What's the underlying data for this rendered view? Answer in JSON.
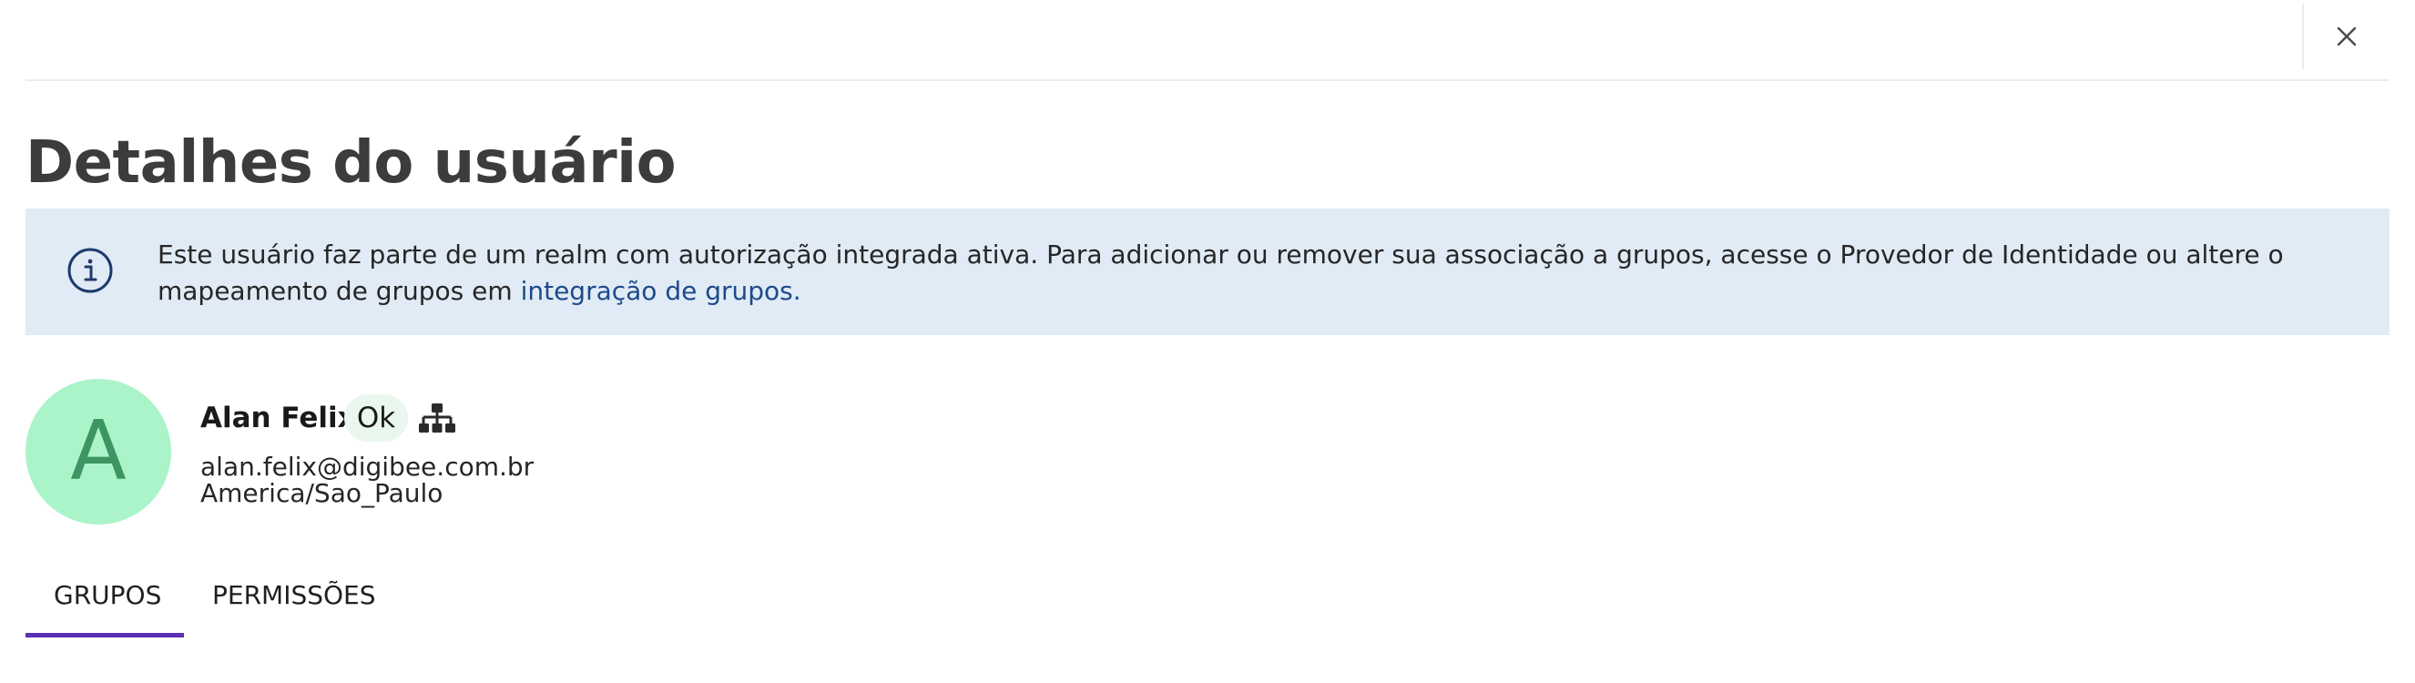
{
  "header": {
    "close_icon": "close-icon"
  },
  "page": {
    "title": "Detalhes do usuário"
  },
  "banner": {
    "icon": "info-icon",
    "text": "Este usuário faz parte de um realm com autorização integrada ativa. Para adicionar ou remover sua associação a grupos, acesse o Provedor de Identidade ou altere o mapeamento de grupos em ",
    "link_label": "integração de grupos.",
    "background": "#e0ebf6",
    "link_color": "#1e4a8a"
  },
  "user": {
    "avatar_letter": "A",
    "avatar_color": "#abf4ca",
    "name": "Alan Felix",
    "status": "Ok",
    "org_icon": "org-chart-icon",
    "email": "alan.felix@digibee.com.br",
    "timezone": "America/Sao_Paulo"
  },
  "tabs": [
    {
      "label": "GRUPOS",
      "active": true
    },
    {
      "label": "PERMISSÕES",
      "active": false
    }
  ],
  "accent_color": "#5b2fb3"
}
